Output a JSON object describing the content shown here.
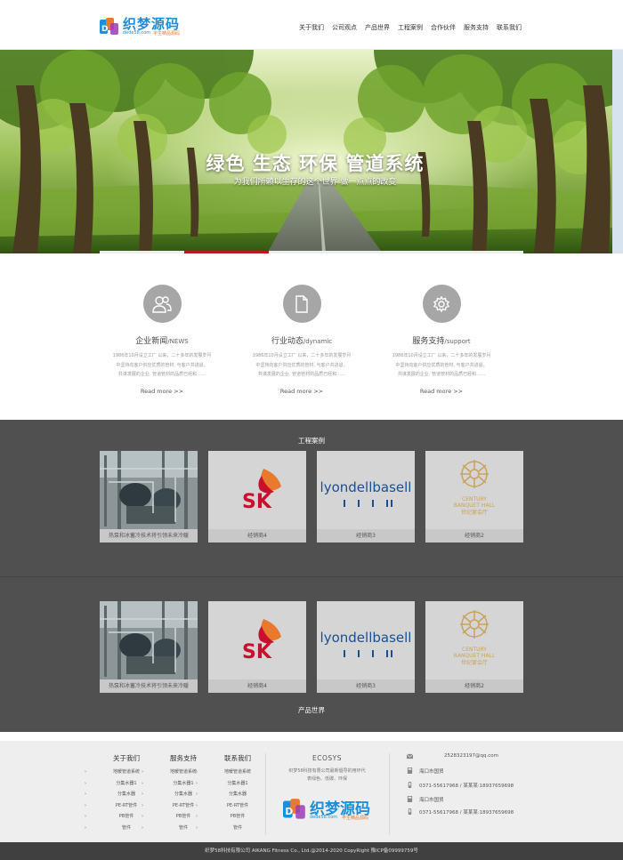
{
  "header": {
    "logo": {
      "text": "织梦源码",
      "sub": "dede58.com",
      "sub2": "丰生精品源码"
    },
    "nav": [
      "关于我们",
      "公司观点",
      "产品世界",
      "工程案例",
      "合作伙伴",
      "服务支持",
      "联系我们"
    ]
  },
  "banner": {
    "title": "绿色 生态 环保 管道系统",
    "subtitle": "为我们所赖以生存的这个世界 做一点点的改变",
    "slide_progress": 0.2
  },
  "features": [
    {
      "title": "企业新闻",
      "title_en": "/NEWS",
      "icon": "users-icon",
      "desc": [
        "1986年10月设立工厂 以来，二十多年的发展岁月",
        "中坚持向客户供应优质的管材, 与客户共进退，",
        "共谋发展的企业. 管道管材的品质已经和……"
      ],
      "more": "Read more >>"
    },
    {
      "title": "行业动态",
      "title_en": "/dynamic",
      "icon": "document-icon",
      "desc": [
        "1986年10月设立工厂 以来，二十多年的发展岁月",
        "中坚持向客户供应优质的管材, 与客户共进退，",
        "共谋发展的企业. 管道管材的品质已经和……"
      ],
      "more": "Read more >>"
    },
    {
      "title": "服务支持",
      "title_en": "/support",
      "icon": "gear-icon",
      "desc": [
        "1986年10月设立工厂 以来，二十多年的发展岁月",
        "中坚持向客户供应优质的管材, 与客户共进退，",
        "共谋发展的企业. 管道管材的品质已经和……"
      ],
      "more": "Read more >>"
    }
  ],
  "cases": {
    "title": "工程案例",
    "items": [
      {
        "label": "热泵和冰蓄冷技术将引领未来冷暖",
        "image": "machinery-photo"
      },
      {
        "label": "经销商4",
        "image": "sk-logo"
      },
      {
        "label": "经销商3",
        "image": "lyondellbasell-logo"
      },
      {
        "label": "经销商2",
        "image": "century-banquet-hall-logo"
      }
    ]
  },
  "products": {
    "title": "产品世界",
    "items": [
      {
        "label": "热泵和冰蓄冷技术将引领未来冷暖",
        "image": "machinery-photo"
      },
      {
        "label": "经销商4",
        "image": "sk-logo"
      },
      {
        "label": "经销商3",
        "image": "lyondellbasell-logo"
      },
      {
        "label": "经销商2",
        "image": "century-banquet-hall-logo"
      }
    ]
  },
  "logos": {
    "sk": "SK",
    "lyondell": "lyondellbasell",
    "century_1": "CENTURY",
    "century_2": "BANQUET HALL",
    "century_3": "世纪宴会厅"
  },
  "footer": {
    "columns": [
      {
        "heading": "关于我们",
        "items": [
          "地暖管道系统",
          "分集水器1",
          "分集水器",
          "PE-RT管件",
          "PB管件",
          "管件"
        ]
      },
      {
        "heading": "服务支持",
        "items": [
          "地暖管道系统",
          "分集水器1",
          "分集水器",
          "PE-RT管件",
          "PB管件",
          "管件"
        ]
      },
      {
        "heading": "联系我们",
        "items": [
          "地暖管道系统",
          "分集水器1",
          "分集水器",
          "PE-RT管件",
          "PB管件",
          "管件"
        ]
      }
    ],
    "eco": {
      "heading": "ECOSYS",
      "desc": [
        "织梦58科技有限公司最新倡导的用环代",
        "表绿色、低碳、环保"
      ]
    },
    "contact": [
      {
        "icon": "mail-icon",
        "text": "2528323197@qq.com"
      },
      {
        "icon": "location-icon",
        "text": "海口市国贸"
      },
      {
        "icon": "phone-icon",
        "text": "0371-55617968 / 某某某:18937659698"
      },
      {
        "icon": "location-icon",
        "text": "海口市国贸"
      },
      {
        "icon": "phone-icon",
        "text": "0371-55617968 / 某某某:18937659698"
      }
    ],
    "copyright": "织梦58科技有限公司 AIKANG Fitness Co., Ltd.@2014-2020 CopyRight 豫ICP备09999759号"
  },
  "colors": {
    "accent": "#b7191c",
    "logo_blue": "#1b8fd9",
    "dark_section": "#505050",
    "footer_bg": "#eeeeee",
    "copyright_bg": "#404040"
  }
}
